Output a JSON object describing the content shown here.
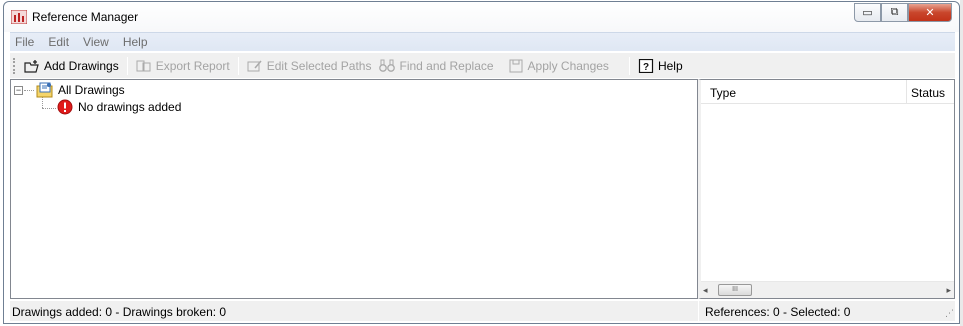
{
  "window": {
    "title": "Reference Manager",
    "buttons": {
      "minimize": "▭",
      "restore": "⧉",
      "close": "✕"
    }
  },
  "menu": [
    "File",
    "Edit",
    "View",
    "Help"
  ],
  "toolbar": {
    "add_drawings": "Add Drawings",
    "export_report": "Export Report",
    "edit_selected_paths": "Edit Selected Paths",
    "find_and_replace": "Find and Replace",
    "apply_changes": "Apply Changes",
    "help": "Help"
  },
  "tree": {
    "expander": "−",
    "root_label": "All Drawings",
    "child_label": "No drawings added"
  },
  "references": {
    "columns": {
      "type": "Type",
      "status": "Status"
    },
    "scroll_left": "◂",
    "scroll_right": "▸",
    "scroll_thumb": "III"
  },
  "status": {
    "left": "Drawings added: 0  -  Drawings broken: 0",
    "right": "References: 0  -  Selected: 0",
    "grip": "⋰"
  },
  "colors": {
    "titlebar_close": "#c23219",
    "menubar": "#e2e9f5",
    "error_icon": "#e01b1b",
    "disabled_text": "#a3a3a3"
  }
}
